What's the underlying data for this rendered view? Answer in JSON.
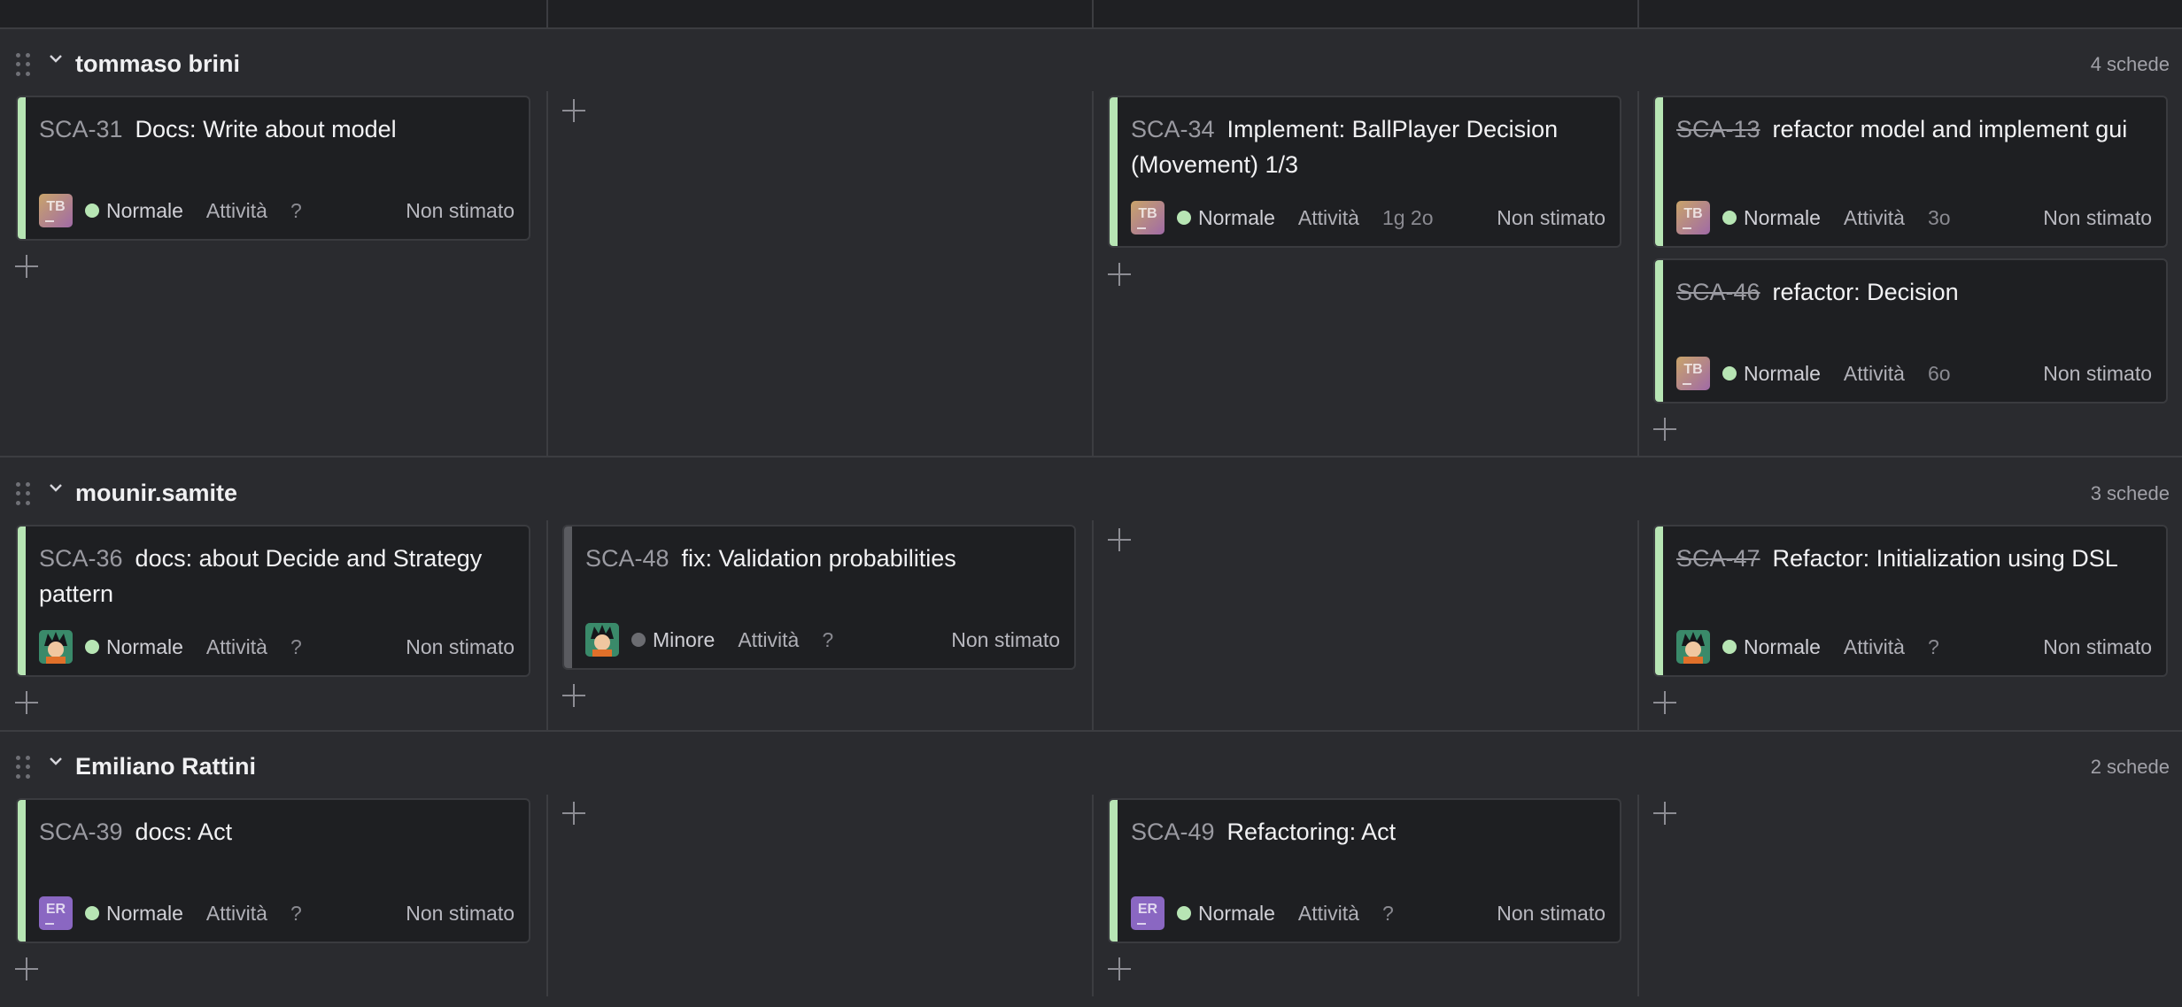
{
  "colors": {
    "status_bar_green": "#b7e5b4",
    "status_bar_gray": "#5a5b60",
    "priority_normal": "#b7e5b4",
    "priority_minor": "#6b6c71"
  },
  "groups": [
    {
      "name": "tommaso brini",
      "count": "4 schede"
    },
    {
      "name": "mounir.samite",
      "count": "3 schede"
    },
    {
      "name": "Emiliano Rattini",
      "count": "2 schede"
    }
  ],
  "cards": [
    {
      "key": "SCA-31",
      "title": "Docs: Write about model",
      "avatar": "TB",
      "priority": "Normale",
      "type": "Attività",
      "time": "?",
      "estimate": "Non stimato"
    },
    {
      "key": "SCA-34",
      "title": "Implement: BallPlayer Decision (Movement) 1/3",
      "avatar": "TB",
      "priority": "Normale",
      "type": "Attività",
      "time": "1g 2o",
      "estimate": "Non stimato"
    },
    {
      "key": "SCA-13",
      "title": "refactor model and implement gui",
      "avatar": "TB",
      "priority": "Normale",
      "type": "Attività",
      "time": "3o",
      "estimate": "Non stimato"
    },
    {
      "key": "SCA-46",
      "title": "refactor: Decision",
      "avatar": "TB",
      "priority": "Normale",
      "type": "Attività",
      "time": "6o",
      "estimate": "Non stimato"
    },
    {
      "key": "SCA-36",
      "title": "docs: about Decide and Strategy pattern",
      "avatar": "goku-avatar",
      "priority": "Normale",
      "type": "Attività",
      "time": "?",
      "estimate": "Non stimato"
    },
    {
      "key": "SCA-48",
      "title": "fix: Validation probabilities",
      "avatar": "goku-avatar",
      "priority": "Minore",
      "type": "Attività",
      "time": "?",
      "estimate": "Non stimato"
    },
    {
      "key": "SCA-47",
      "title": "Refactor: Initialization using DSL",
      "avatar": "goku-avatar",
      "priority": "Normale",
      "type": "Attività",
      "time": "?",
      "estimate": "Non stimato"
    },
    {
      "key": "SCA-39",
      "title": "docs: Act",
      "avatar": "ER",
      "priority": "Normale",
      "type": "Attività",
      "time": "?",
      "estimate": "Non stimato"
    },
    {
      "key": "SCA-49",
      "title": "Refactoring: Act",
      "avatar": "ER",
      "priority": "Normale",
      "type": "Attività",
      "time": "?",
      "estimate": "Non stimato"
    }
  ]
}
